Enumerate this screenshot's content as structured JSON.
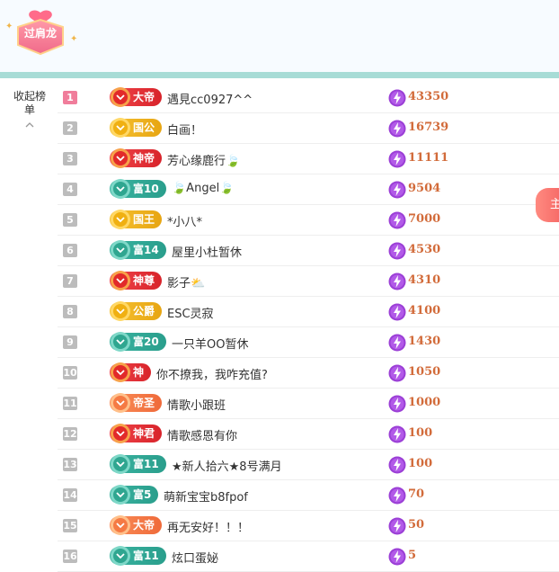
{
  "header": {
    "logo_text": "过肩龙"
  },
  "collapse_label": "收起榜单",
  "side_tab_label": "主",
  "colors": {
    "pink": "#f07d9b",
    "score": "#d26b3a",
    "teal": "#a7dcd6"
  },
  "rows": [
    {
      "rank": "1",
      "level": "大帝",
      "style": "red",
      "name": "遇見cc0927^^",
      "score": "43350"
    },
    {
      "rank": "2",
      "level": "国公",
      "style": "gold",
      "name": "白画！",
      "score": "16739"
    },
    {
      "rank": "3",
      "level": "神帝",
      "style": "red",
      "name": "芳心缘鹿行🍃",
      "score": "11111"
    },
    {
      "rank": "4",
      "level": "富10",
      "style": "teal",
      "name": "🍃Angel🍃",
      "score": "9504"
    },
    {
      "rank": "5",
      "level": "国王",
      "style": "gold",
      "name": "*小八*",
      "score": "7000"
    },
    {
      "rank": "6",
      "level": "富14",
      "style": "teal",
      "name": "屋里小杜暂休",
      "score": "4530"
    },
    {
      "rank": "7",
      "level": "神尊",
      "style": "red",
      "name": "影子⛅",
      "score": "4310"
    },
    {
      "rank": "8",
      "level": "公爵",
      "style": "gold",
      "name": "ESC灵寂",
      "score": "4100"
    },
    {
      "rank": "9",
      "level": "富20",
      "style": "teal",
      "name": "一只羊OO暂休",
      "score": "1430"
    },
    {
      "rank": "10",
      "level": "神",
      "style": "red",
      "name": "你不撩我，我咋充值?",
      "score": "1050"
    },
    {
      "rank": "11",
      "level": "帝圣",
      "style": "orange",
      "name": "情歌小跟班",
      "score": "1000"
    },
    {
      "rank": "12",
      "level": "神君",
      "style": "red",
      "name": "情歌感恩有你",
      "score": "100"
    },
    {
      "rank": "13",
      "level": "富11",
      "style": "teal",
      "name": "★新人拾六★8号满月",
      "score": "100"
    },
    {
      "rank": "14",
      "level": "富5",
      "style": "teal",
      "name": "萌新宝宝b8fpof",
      "score": "70"
    },
    {
      "rank": "15",
      "level": "大帝",
      "style": "orange",
      "name": "再无安好！！！",
      "score": "50"
    },
    {
      "rank": "16",
      "level": "富11",
      "style": "teal",
      "name": "炫口蛋妼",
      "score": "5"
    }
  ]
}
